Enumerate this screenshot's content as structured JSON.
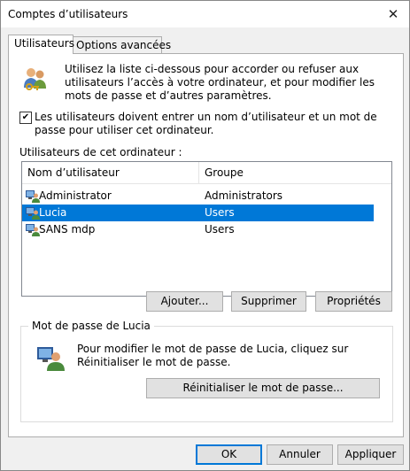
{
  "window": {
    "title": "Comptes d’utilisateurs",
    "close_glyph": "✕"
  },
  "tabs": [
    {
      "label": "Utilisateurs",
      "active": true
    },
    {
      "label": "Options avancées",
      "active": false
    }
  ],
  "info": {
    "text": "Utilisez la liste ci-dessous pour accorder ou refuser aux utilisateurs l’accès à votre ordinateur, et pour modifier les mots de passe et d’autres paramètres.",
    "icon": "users-keys-icon"
  },
  "require_login": {
    "checked": true,
    "label": "Les utilisateurs doivent entrer un nom d’utilisateur et un mot de passe pour utiliser cet ordinateur."
  },
  "users_list": {
    "label": "Utilisateurs de cet ordinateur :",
    "columns": [
      "Nom d’utilisateur",
      "Groupe"
    ],
    "rows": [
      {
        "name": "Administrator",
        "group": "Administrators",
        "selected": false
      },
      {
        "name": "Lucia",
        "group": "Users",
        "selected": true
      },
      {
        "name": "SANS mdp",
        "group": "Users",
        "selected": false
      }
    ],
    "row_icon": "user-computer-icon",
    "selection_color": "#0078d7"
  },
  "list_buttons": {
    "add": "Ajouter...",
    "remove": "Supprimer",
    "properties": "Propriétés"
  },
  "password_group": {
    "title": "Mot de passe de Lucia",
    "text": "Pour modifier le mot de passe de Lucia, cliquez sur Réinitialiser le mot de passe.",
    "reset_button": "Réinitialiser le mot de passe...",
    "icon": "user-password-icon"
  },
  "footer_buttons": {
    "ok": "OK",
    "cancel": "Annuler",
    "apply": "Appliquer"
  }
}
